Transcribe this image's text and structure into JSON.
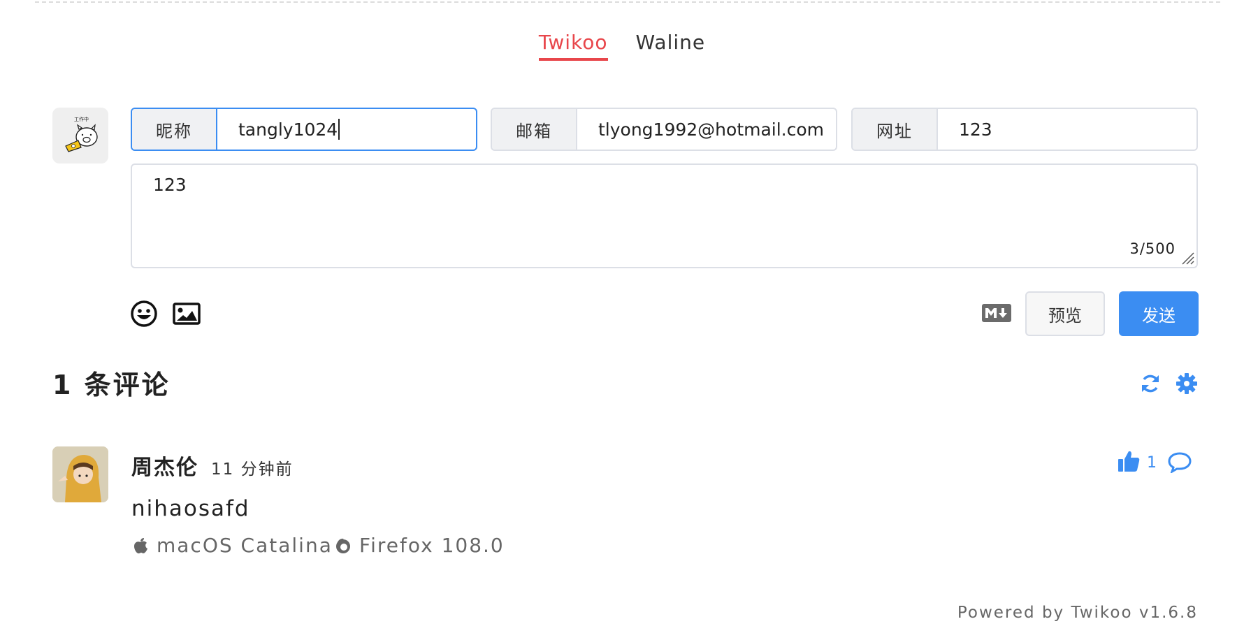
{
  "tabs": [
    {
      "label": "Twikoo",
      "active": true
    },
    {
      "label": "Waline",
      "active": false
    }
  ],
  "form": {
    "nick": {
      "label": "昵称",
      "value": "tangly1024"
    },
    "mail": {
      "label": "邮箱",
      "value": "tlyong1992@hotmail.com"
    },
    "link": {
      "label": "网址",
      "value": "123"
    },
    "content": "123",
    "counter": "3/500",
    "preview_label": "预览",
    "send_label": "发送"
  },
  "comments_header": {
    "title": "1 条评论"
  },
  "comments": [
    {
      "nick": "周杰伦",
      "time": "11 分钟前",
      "likes": "1",
      "content": "nihaosafd",
      "os": "macOS Catalina",
      "browser": "Firefox 108.0"
    }
  ],
  "footer": {
    "powered": "Powered by Twikoo v1.6.8"
  },
  "colors": {
    "accent": "#3b8df2",
    "tab_active": "#e8464b"
  }
}
